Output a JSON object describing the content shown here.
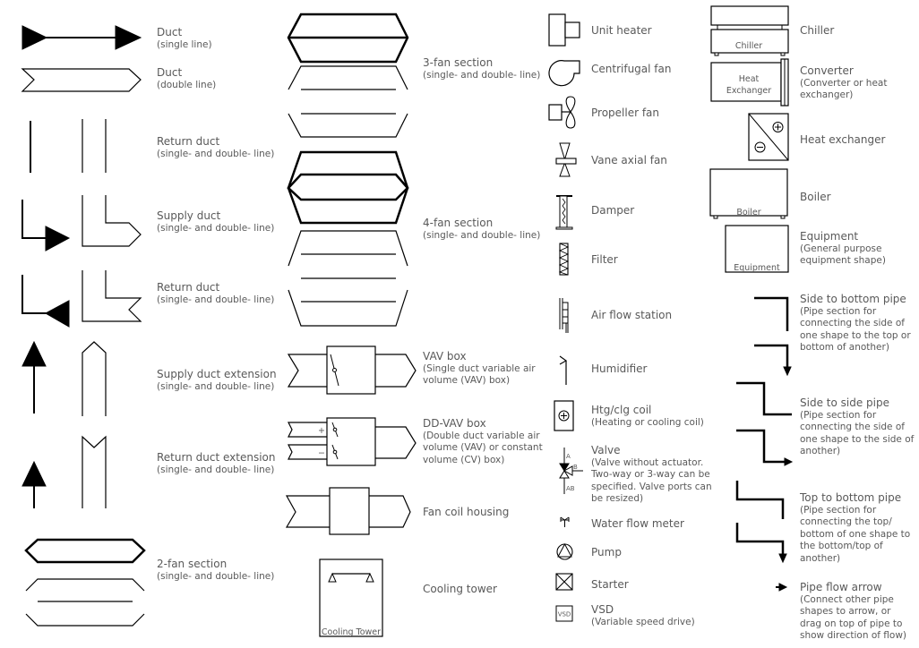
{
  "symbols": {
    "duct_single": {
      "title": "Duct",
      "desc": "(single line)"
    },
    "duct_double": {
      "title": "Duct",
      "desc": "(double line)"
    },
    "return_duct": {
      "title": "Return duct",
      "desc": "(single- and double- line)"
    },
    "supply_duct": {
      "title": "Supply duct",
      "desc": "(single- and double- line)"
    },
    "return_duct_2": {
      "title": "Return duct",
      "desc": "(single- and double- line)"
    },
    "supply_duct_ext": {
      "title": "Supply duct extension",
      "desc": "(single- and double- line)"
    },
    "return_duct_ext": {
      "title": "Return duct extension",
      "desc": "(single- and double- line)"
    },
    "fan2": {
      "title": "2-fan section",
      "desc": "(single- and double- line)"
    },
    "fan3": {
      "title": "3-fan section",
      "desc": "(single- and double- line)"
    },
    "fan4": {
      "title": "4-fan section",
      "desc": "(single- and double- line)"
    },
    "vav": {
      "title": "VAV box",
      "desc1": "(Single duct variable air",
      "desc2": "volume (VAV) box)"
    },
    "ddvav": {
      "title": "DD-VAV box",
      "desc1": "(Double duct variable air",
      "desc2": "volume (VAV) or constant",
      "desc3": "volume (CV) box)",
      "plus": "+",
      "minus": "−"
    },
    "fan_coil": {
      "title": "Fan coil housing"
    },
    "cooling_tower": {
      "title": "Cooling tower",
      "inner": "Cooling Tower"
    },
    "unit_heater": {
      "title": "Unit heater"
    },
    "centrifugal_fan": {
      "title": "Centrifugal fan"
    },
    "propeller_fan": {
      "title": "Propeller fan"
    },
    "vane_axial_fan": {
      "title": "Vane axial fan"
    },
    "damper": {
      "title": "Damper"
    },
    "filter": {
      "title": "Filter"
    },
    "air_flow_station": {
      "title": "Air flow station"
    },
    "humidifier": {
      "title": "Humidifier"
    },
    "coil": {
      "title": "Htg/clg coil",
      "desc": "(Heating or cooling coil)"
    },
    "valve": {
      "title": "Valve",
      "desc1": "(Valve without actuator.",
      "desc2": "Two-way or 3-way can be",
      "desc3": "specified. Valve ports can",
      "desc4": "be resized)",
      "port_a": "A",
      "port_b": "B",
      "port_ab": "AB"
    },
    "water_flow_meter": {
      "title": "Water flow meter"
    },
    "pump": {
      "title": "Pump"
    },
    "starter": {
      "title": "Starter"
    },
    "vsd": {
      "title": "VSD",
      "desc": "(Variable speed drive)",
      "inner": "VSD"
    },
    "chiller": {
      "title": "Chiller",
      "inner": "Chiller"
    },
    "converter": {
      "title": "Converter",
      "desc1": "(Converter or heat",
      "desc2": "exchanger)",
      "inner1": "Heat",
      "inner2": "Exchanger"
    },
    "heat_exchanger": {
      "title": "Heat exchanger"
    },
    "boiler": {
      "title": "Boiler",
      "inner": "Boiler"
    },
    "equipment": {
      "title": "Equipment",
      "desc1": "(General purpose",
      "desc2": "equipment shape)",
      "inner": "Equipment"
    },
    "side_to_bottom": {
      "title": "Side to bottom pipe",
      "desc1": "(Pipe section for",
      "desc2": "connecting the side of",
      "desc3": "one shape to the top or",
      "desc4": "bottom of another)"
    },
    "side_to_side": {
      "title": "Side to side pipe",
      "desc1": "(Pipe section for",
      "desc2": "connecting the side of",
      "desc3": "one shape to the side of",
      "desc4": "another)"
    },
    "top_to_bottom": {
      "title": "Top to bottom pipe",
      "desc1": "(Pipe section for",
      "desc2": "connecting the top/",
      "desc3": "bottom of one shape to",
      "desc4": "the bottom/top of",
      "desc5": "another)"
    },
    "pipe_flow_arrow": {
      "title": "Pipe flow arrow",
      "desc1": "(Connect other pipe",
      "desc2": "shapes to arrow, or",
      "desc3": "drag on top of pipe to",
      "desc4": "show direction of flow)"
    }
  }
}
